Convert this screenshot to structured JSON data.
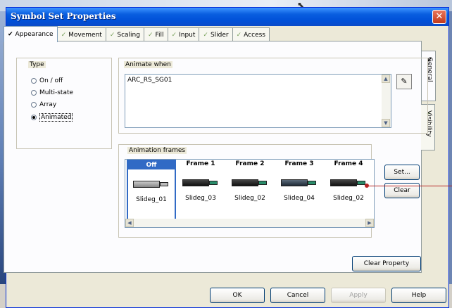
{
  "window": {
    "title": "Symbol Set Properties",
    "close_glyph": "✕"
  },
  "tabs": [
    {
      "label": "Appearance",
      "active": true
    },
    {
      "label": "Movement"
    },
    {
      "label": "Scaling"
    },
    {
      "label": "Fill"
    },
    {
      "label": "Input"
    },
    {
      "label": "Slider"
    },
    {
      "label": "Access"
    }
  ],
  "side_tabs": [
    {
      "label": "General"
    },
    {
      "label": "Visibility"
    }
  ],
  "type_group": {
    "legend": "Type",
    "options": [
      {
        "label": "On / off",
        "selected": false
      },
      {
        "label": "Multi-state",
        "selected": false
      },
      {
        "label": "Array",
        "selected": false
      },
      {
        "label": "Animated",
        "selected": true
      }
    ]
  },
  "animate_when": {
    "legend": "Animate when",
    "value": "ARC_RS_SG01",
    "wand_icon": "wand-icon"
  },
  "animation_frames": {
    "legend": "Animation frames",
    "frames": [
      {
        "header": "Off",
        "name": "Slideg_01",
        "state": "off",
        "selected": true
      },
      {
        "header": "Frame 1",
        "name": "Slideg_03",
        "state": "run"
      },
      {
        "header": "Frame 2",
        "name": "Slideg_02",
        "state": "run"
      },
      {
        "header": "Frame 3",
        "name": "Slideg_04",
        "state": "run"
      },
      {
        "header": "Frame 4",
        "name": "Slideg_02",
        "state": "run"
      }
    ],
    "set_label": "Set...",
    "clear_label": "Clear"
  },
  "clear_property_label": "Clear Property",
  "footer": {
    "ok": "OK",
    "cancel": "Cancel",
    "apply": "Apply",
    "help": "Help"
  },
  "colors": {
    "titlebar": "#0a5fe0",
    "selection": "#316ac5",
    "annotation_line": "#b62323"
  }
}
